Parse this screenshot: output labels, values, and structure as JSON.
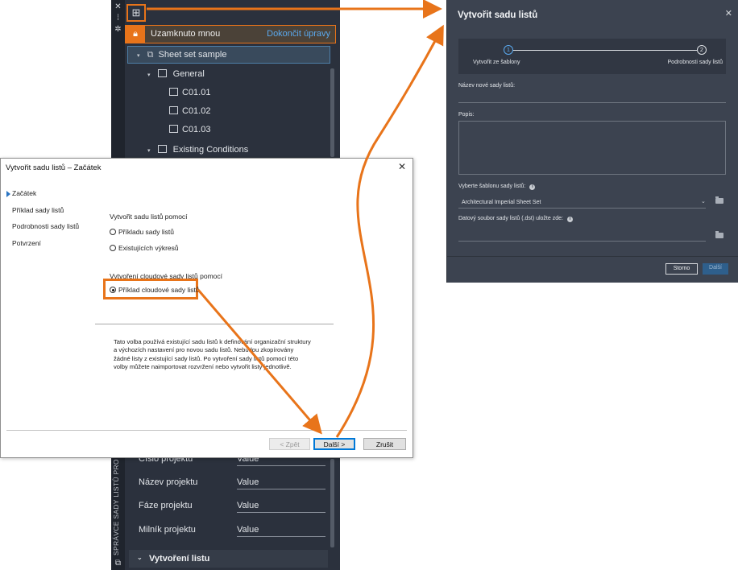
{
  "palette": {
    "vertical_title": "SPRÁVCE SADY LISTŮ PRO WEB",
    "lock_text": "Uzamknuto mnou",
    "lock_link": "Dokončit úpravy",
    "tree": {
      "root": "Sheet set sample",
      "general": "General",
      "sheets": [
        "C01.01",
        "C01.02",
        "C01.03"
      ],
      "existing": "Existing Conditions"
    },
    "properties": [
      {
        "label": "Číslo projektu",
        "value": "Value"
      },
      {
        "label": "Název projektu",
        "value": "Value"
      },
      {
        "label": "Fáze projektu",
        "value": "Value"
      },
      {
        "label": "Milník projektu",
        "value": "Value"
      }
    ],
    "section": "Vytvoření listu"
  },
  "dialog": {
    "title": "Vytvořit sadu listů – Začátek",
    "close": "✕",
    "steps": [
      "Začátek",
      "Příklad sady listů",
      "Podrobnosti sady listů",
      "Potvrzení"
    ],
    "group1_label": "Vytvořit sadu listů pomocí",
    "option1": "Příkladu sady listů",
    "option2": "Existujících výkresů",
    "group2_label": "Vytvoření cloudové sady listů pomocí",
    "option3": "Příklad cloudové sady listů",
    "description": "Tato volba používá existující sadu listů k definování organizační struktury a výchozích nastavení pro novou sadu listů. Nebudou zkopírovány žádné listy z existující sady listů. Po vytvoření sady listů pomocí této volby můžete naimportovat rozvržení nebo vytvořit listy jednotlivě.",
    "btn_back": "< Zpět",
    "btn_next": "Další >",
    "btn_cancel": "Zrušit"
  },
  "web_dialog": {
    "title": "Vytvořit sadu listů",
    "close": "✕",
    "step1_num": "1",
    "step1_label": "Vytvořit ze šablony",
    "step2_num": "2",
    "step2_label": "Podrobnosti sady listů",
    "name_label": "Název nové sady listů:",
    "desc_label": "Popis:",
    "template_label": "Vyberte šablonu sady listů:",
    "template_value": "Architectural Imperial Sheet Set",
    "dst_label": "Datový soubor sady listů (.dst) uložte zde:",
    "btn_cancel": "Storno",
    "btn_next": "Další"
  },
  "colors": {
    "accent": "#e8741a",
    "link": "#5aa9ef",
    "palette_bg": "#2b313d",
    "web_bg": "#3c4350"
  },
  "icons": [
    "close-icon",
    "gear-icon",
    "new-sheet-set-icon",
    "lock-icon",
    "chevron-down-icon",
    "sheet-set-icon",
    "sheet-icon",
    "info-icon",
    "folder-icon",
    "caret-right-icon"
  ]
}
